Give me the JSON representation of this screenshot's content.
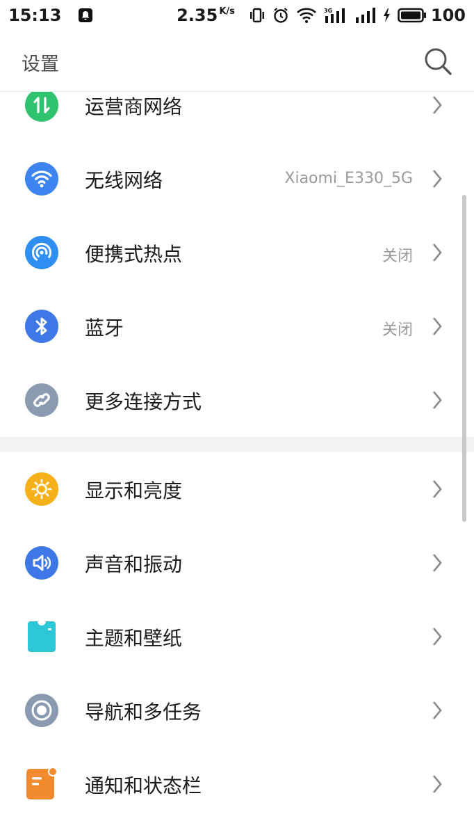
{
  "status_bar": {
    "time": "15:13",
    "net_speed": "2.35",
    "net_speed_unit": "K/s",
    "network_type": "3G",
    "battery_level": "100"
  },
  "header": {
    "title": "设置",
    "search_icon": "search-icon"
  },
  "settings": {
    "section1": [
      {
        "label": "运营商网络",
        "value": "",
        "icon": "mobile-data-icon",
        "color": "#2fc26f"
      },
      {
        "label": "无线网络",
        "value": "Xiaomi_E330_5G",
        "icon": "wifi-icon",
        "color": "#3d84f0"
      },
      {
        "label": "便携式热点",
        "value": "关闭",
        "icon": "hotspot-icon",
        "color": "#2e8ef2"
      },
      {
        "label": "蓝牙",
        "value": "关闭",
        "icon": "bluetooth-icon",
        "color": "#3d78e6"
      },
      {
        "label": "更多连接方式",
        "value": "",
        "icon": "link-icon",
        "color": "#8a9ab0"
      }
    ],
    "section2": [
      {
        "label": "显示和亮度",
        "value": "",
        "icon": "brightness-icon",
        "color": "#f6b01a"
      },
      {
        "label": "声音和振动",
        "value": "",
        "icon": "sound-icon",
        "color": "#3d78e6"
      },
      {
        "label": "主题和壁纸",
        "value": "",
        "icon": "theme-icon",
        "color": "#2ec7d8"
      },
      {
        "label": "导航和多任务",
        "value": "",
        "icon": "navigation-icon",
        "color": "#8a9ab0"
      },
      {
        "label": "通知和状态栏",
        "value": "",
        "icon": "notification-icon",
        "color": "#f28a2e"
      }
    ]
  }
}
